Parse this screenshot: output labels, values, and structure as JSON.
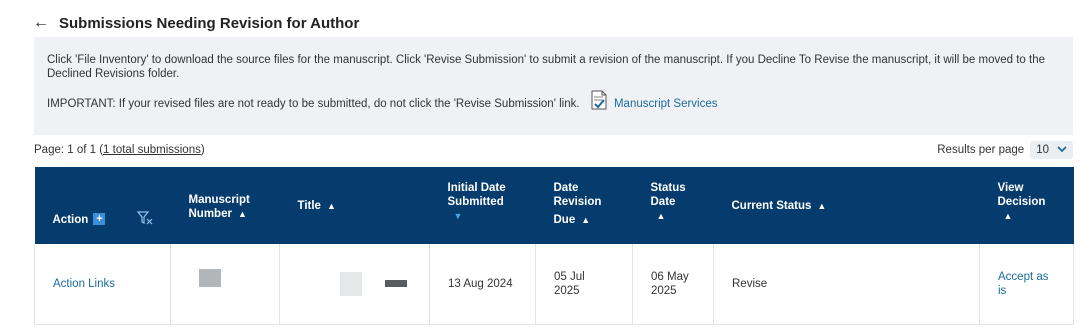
{
  "header": {
    "back_glyph": "←",
    "title": "Submissions Needing Revision for Author"
  },
  "info": {
    "paragraph1": "Click 'File Inventory' to download the source files for the manuscript. Click 'Revise Submission' to submit a revision of the manuscript. If you Decline To Revise the manuscript, it will be moved to the Declined Revisions folder.",
    "paragraph2": "IMPORTANT: If your revised files are not ready to be submitted, do not click the 'Revise Submission' link.",
    "services_link": "Manuscript Services"
  },
  "pager": {
    "page_prefix": "Page: 1 of 1 (",
    "total_link": "1 total submissions",
    "page_suffix": ")",
    "rpp_label": "Results per page",
    "rpp_value": "10"
  },
  "table": {
    "columns": {
      "action": "Action",
      "ms_number_l1": "Manuscript",
      "ms_number_l2": "Number",
      "title": "Title",
      "initial_l1": "Initial Date",
      "initial_l2": "Submitted",
      "due_l1": "Date",
      "due_l2": "Revision",
      "due_l3": "Due",
      "status_date_l1": "Status",
      "status_date_l2": "Date",
      "current_status": "Current Status",
      "view_l1": "View",
      "view_l2": "Decision"
    },
    "rows": [
      {
        "action": "Action Links",
        "initial_date": "13 Aug 2024",
        "due_l1": "05 Jul",
        "due_l2": "2025",
        "status_l1": "06 May",
        "status_l2": "2025",
        "current_status": "Revise",
        "view_l1": "Accept as",
        "view_l2": "is"
      }
    ]
  },
  "colors": {
    "header_bg": "#063b6d",
    "link": "#1d6b9c",
    "info_bg": "#eff1f4"
  },
  "icons": [
    "back-arrow-icon",
    "document-check-icon",
    "plus-icon",
    "filter-clear-icon",
    "sort-up-icon",
    "sort-down-icon",
    "chevron-down-icon"
  ]
}
